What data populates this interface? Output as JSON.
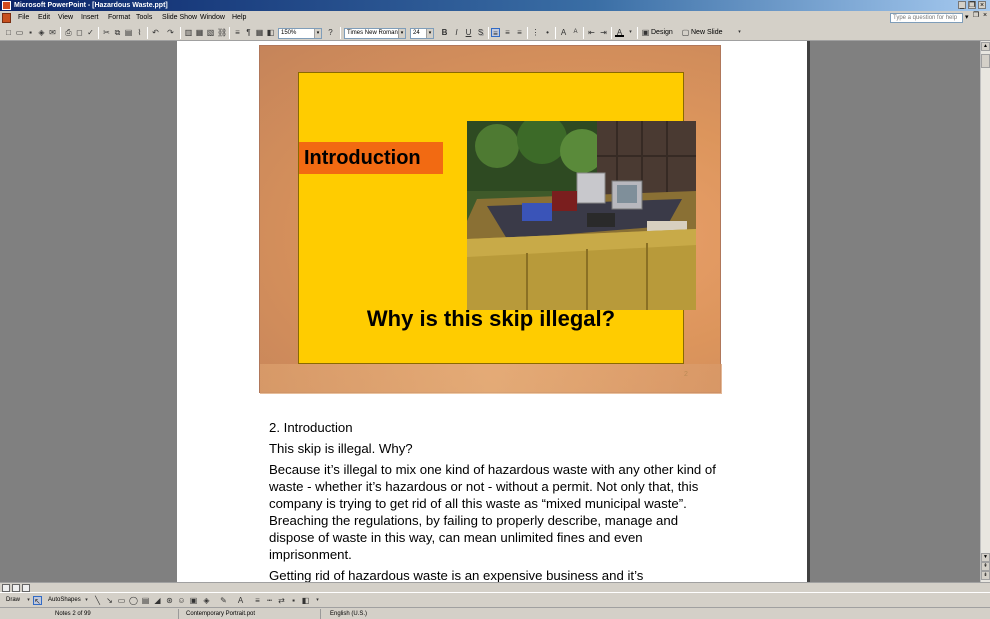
{
  "window": {
    "title": "Microsoft PowerPoint - [Hazardous Waste.ppt]",
    "minimize": "_",
    "restore": "❐",
    "close": "×"
  },
  "menu": {
    "items": [
      "File",
      "Edit",
      "View",
      "Insert",
      "Format",
      "Tools",
      "Slide Show",
      "Window",
      "Help"
    ],
    "help_placeholder": "Type a question for help"
  },
  "toolbar": {
    "zoom": "150%",
    "font": "Times New Roman",
    "font_size": "24",
    "bold": "B",
    "italic": "I",
    "underline": "U",
    "shadow": "S",
    "design": "Design",
    "new_slide": "New Slide"
  },
  "slide": {
    "title": "Introduction",
    "question": "Why is this skip illegal?",
    "number": "2"
  },
  "notes": {
    "heading": "2. Introduction",
    "paragraphs": [
      "This skip is illegal. Why?",
      "Because it’s illegal to mix one kind of hazardous waste with any other kind of waste - whether it’s hazardous or not - without a permit. Not only that, this company is trying to get rid of all this waste as “mixed municipal waste”. Breaching the regulations, by failing to properly describe, manage and dispose of waste in this way, can mean unlimited fines and even imprisonment.",
      "Getting rid of hazardous waste is an expensive business and it’s"
    ]
  },
  "drawing": {
    "draw": "Draw",
    "autoshapes": "AutoShapes"
  },
  "status": {
    "slide": "Notes 2 of 99",
    "design": "Contemporary Portrait.pot",
    "language": "English (U.S.)"
  },
  "colors": {
    "slide_bg": "#ffcc00",
    "title_bar": "#f26a12",
    "frame": "#dc955c"
  }
}
